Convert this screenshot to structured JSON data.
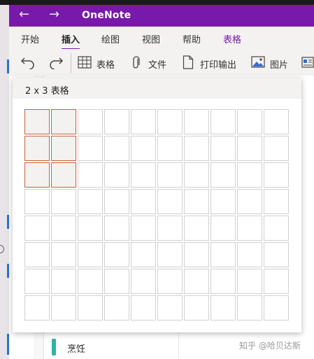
{
  "app": {
    "title": "OneNote"
  },
  "nav": {
    "back_icon": "arrow-left-icon",
    "forward_icon": "arrow-right-icon",
    "back_glyph": "←",
    "forward_glyph": "→"
  },
  "ribbon": {
    "tabs": [
      {
        "label": "开始",
        "active": false
      },
      {
        "label": "插入",
        "active": true
      },
      {
        "label": "绘图",
        "active": false
      },
      {
        "label": "视图",
        "active": false
      },
      {
        "label": "帮助",
        "active": false
      },
      {
        "label": "表格",
        "active": false,
        "contextual": true
      }
    ],
    "toolbar": {
      "undo_icon": "undo-icon",
      "redo_icon": "redo-icon",
      "table_label": "表格",
      "file_label": "文件",
      "printout_label": "打印输出",
      "picture_label": "图片"
    }
  },
  "table_picker": {
    "size_label": "2 x 3 表格",
    "columns": 10,
    "rows": 8,
    "selected_columns": 2,
    "selected_rows": 3
  },
  "sections": {
    "current_label": "烹饪"
  },
  "watermark": "知乎 @哈贝达斯",
  "colors": {
    "accent": "#7719aa",
    "selection": "#c8623c",
    "section": "#2bb5a4"
  }
}
